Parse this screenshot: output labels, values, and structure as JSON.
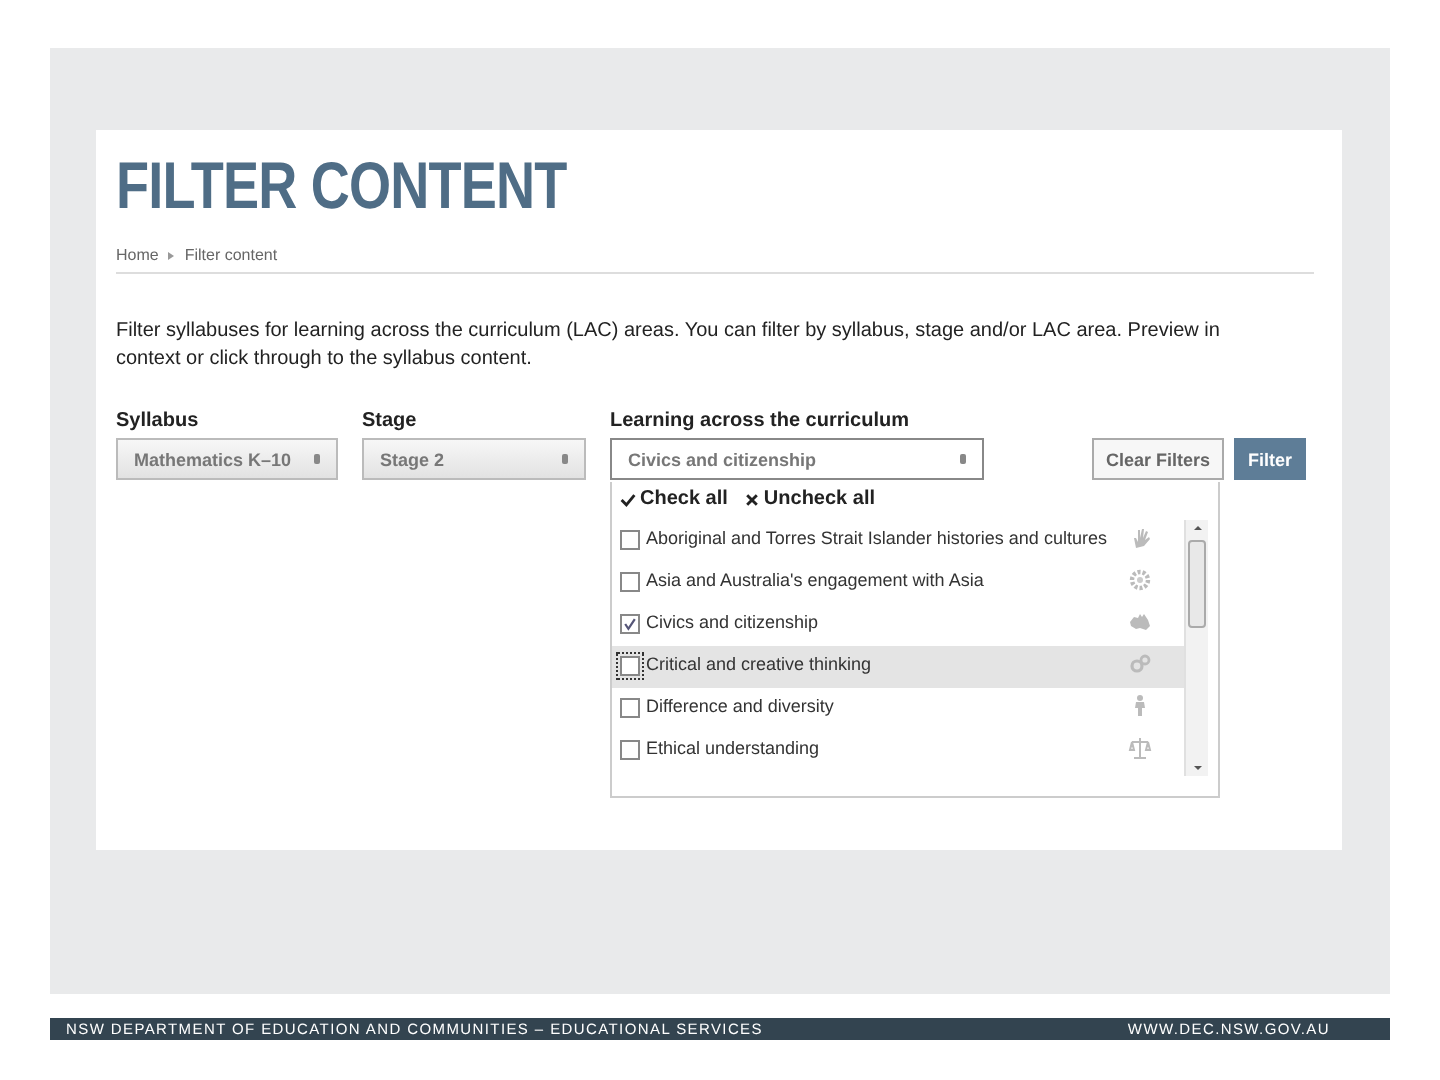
{
  "page": {
    "title": "FILTER CONTENT"
  },
  "breadcrumb": [
    "Home",
    "Filter content"
  ],
  "intro": "Filter syllabuses for learning across the curriculum (LAC) areas. You can filter by syllabus, stage and/or LAC area. Preview in context or click through to the syllabus content.",
  "filters": [
    {
      "label": "Syllabus",
      "value": "Mathematics K–10",
      "open": false
    },
    {
      "label": "Stage",
      "value": "Stage 2",
      "open": false
    },
    {
      "label": "Learning across the curriculum",
      "value": "Civics and citizenship",
      "open": true
    }
  ],
  "buttons": [
    {
      "label": "Clear Filters",
      "primary": false
    },
    {
      "label": "Filter",
      "primary": true
    }
  ],
  "dropdown": {
    "check_all": "Check all",
    "uncheck_all": "Uncheck all",
    "items": [
      {
        "label": "Aboriginal and Torres Strait Islander histories and cultures",
        "checked": false,
        "highlighted": false
      },
      {
        "label": "Asia and Australia's engagement with Asia",
        "checked": false,
        "highlighted": false
      },
      {
        "label": "Civics and citizenship",
        "checked": true,
        "highlighted": false
      },
      {
        "label": "Critical and creative thinking",
        "checked": false,
        "highlighted": true
      },
      {
        "label": "Difference and diversity",
        "checked": false,
        "highlighted": false
      },
      {
        "label": "Ethical understanding",
        "checked": false,
        "highlighted": false
      }
    ]
  },
  "footer": {
    "left": "NSW DEPARTMENT OF EDUCATION AND COMMUNITIES – EDUCATIONAL SERVICES",
    "right": "WWW.DEC.NSW.GOV.AU"
  }
}
